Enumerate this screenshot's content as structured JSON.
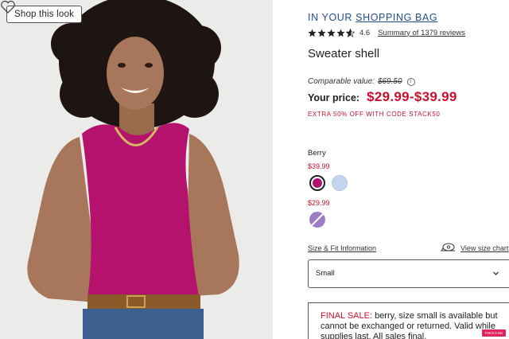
{
  "image_panel": {
    "shop_look_label": "Shop this look",
    "wishlist_icon": "heart-outline-icon"
  },
  "product": {
    "bag_prefix": "IN YOUR ",
    "bag_link": "SHOPPING BAG",
    "rating": {
      "stars": 4.6,
      "value_label": "4.6",
      "reviews_label": "Summary of 1379 reviews"
    },
    "title": "Sweater shell",
    "comparable_label": "Comparable value:",
    "comparable_value": "$69.50",
    "your_price_label": "Your price:",
    "price_range": "$29.99-$39.99",
    "promo": "EXTRA 50% OFF WITH CODE STACK50"
  },
  "color": {
    "selected_name": "Berry",
    "group1_price": "$39.99",
    "group2_price": "$29.99",
    "swatches": [
      {
        "name": "berry",
        "hex": "#b0136e",
        "selected": true
      },
      {
        "name": "light-blue",
        "hex": "#c3d5ec",
        "selected": false
      },
      {
        "name": "purple",
        "hex": "#9d7cc4",
        "unavailable": true
      }
    ]
  },
  "size": {
    "fit_link": "Size & Fit Information",
    "view_chart_link": "View size chart",
    "selected": "Small"
  },
  "final_sale": {
    "label": "FINAL SALE:",
    "message": " berry, size small is available but cannot be exchanged or returned. Valid while supplies last. All sales final."
  },
  "badge": {
    "text": "Fetch it Mo"
  },
  "colors": {
    "accent_blue": "#1f4f8a",
    "price_red": "#c8102e"
  }
}
